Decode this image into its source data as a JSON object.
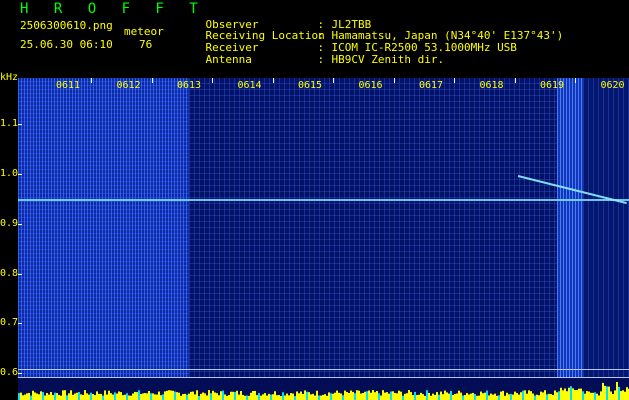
{
  "header": {
    "title": "H R O F F T",
    "filename": "2506300610.png",
    "type_label": "meteor",
    "datetime": "25.06.30 06:10",
    "count": "76",
    "info": [
      {
        "label": "Observer",
        "value": "JL2TBB"
      },
      {
        "label": "Receiving Location",
        "value": "Hamamatsu, Japan (N34°40' E137°43')"
      },
      {
        "label": "Receiver",
        "value": "ICOM IC-R2500 53.1000MHz USB"
      },
      {
        "label": "Antenna",
        "value": "HB9CV Zenith dir."
      }
    ]
  },
  "spectrogram": {
    "y_unit": "kHz",
    "y_ticks": [
      "1.1",
      "1.0",
      "0.9",
      "0.8",
      "0.7",
      "0.6"
    ],
    "x_ticks": [
      "0611",
      "0612",
      "0613",
      "0614",
      "0615",
      "0616",
      "0617",
      "0618",
      "0619",
      "0620"
    ],
    "colors": {
      "background": "#030d55",
      "carrier": "#7fe0ff",
      "noise_bar": "#ffff00",
      "label": "#ffff00",
      "title": "#00ff00"
    }
  }
}
